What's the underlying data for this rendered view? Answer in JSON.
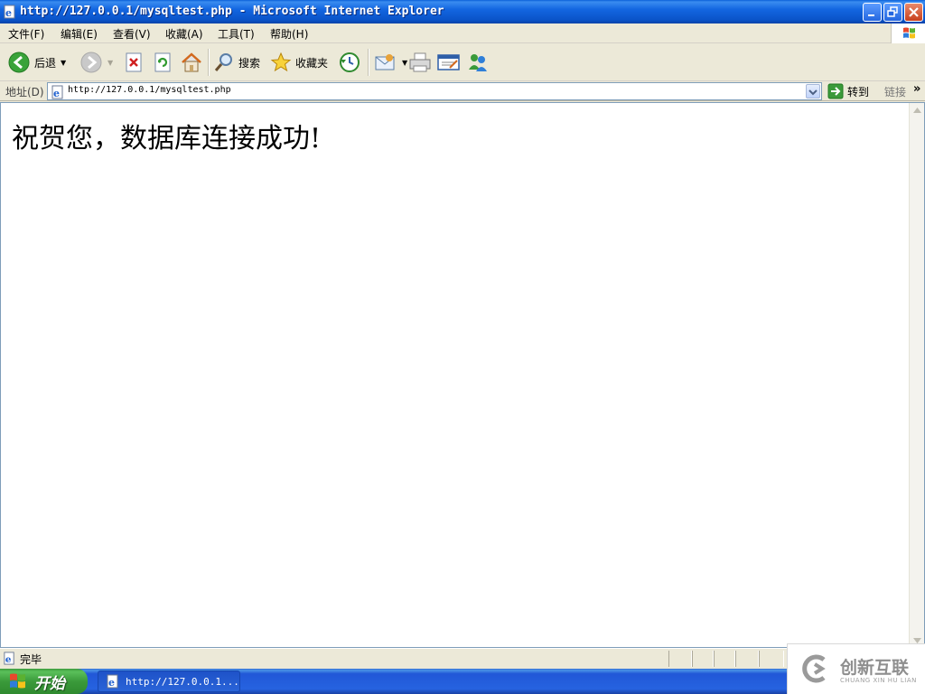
{
  "window": {
    "title": "http://127.0.0.1/mysqltest.php - Microsoft Internet Explorer"
  },
  "menubar": {
    "items": [
      {
        "label": "文件(F)"
      },
      {
        "label": "编辑(E)"
      },
      {
        "label": "查看(V)"
      },
      {
        "label": "收藏(A)"
      },
      {
        "label": "工具(T)"
      },
      {
        "label": "帮助(H)"
      }
    ]
  },
  "toolbar": {
    "back_label": "后退",
    "search_label": "搜索",
    "favorites_label": "收藏夹"
  },
  "addressbar": {
    "label": "地址(D)",
    "url": "http://127.0.0.1/mysqltest.php",
    "go_label": "转到",
    "links_label": "链接",
    "more_glyph": "»"
  },
  "content": {
    "message": "祝贺您，数据库连接成功!"
  },
  "statusbar": {
    "text": "完毕"
  },
  "taskbar": {
    "start_label": "开始",
    "task_label": "http://127.0.0.1..."
  },
  "watermark": {
    "brand": "创新互联",
    "sub": "CHUANG XIN HU LIAN"
  },
  "colors": {
    "title_bar": "#0A53C8",
    "chrome": "#ECE9D8",
    "taskbar": "#2663E0",
    "start_button": "#3A9A3A",
    "close_button": "#C8401E"
  }
}
